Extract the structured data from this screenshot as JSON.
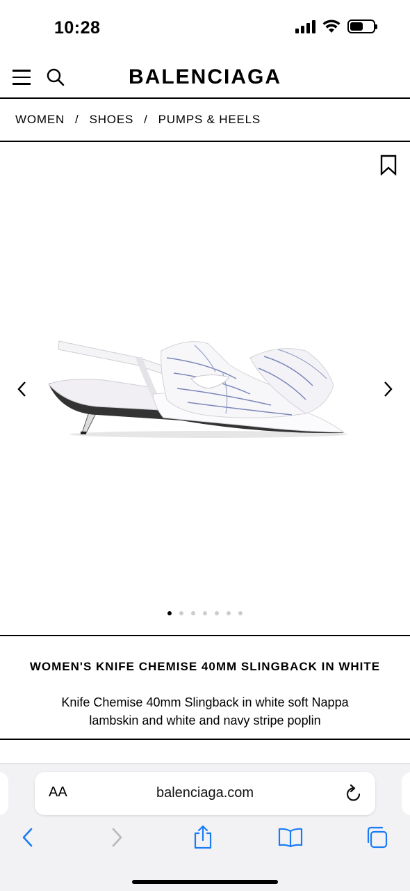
{
  "status_bar": {
    "time": "10:28"
  },
  "header": {
    "brand": "BALENCIAGA"
  },
  "breadcrumb": [
    {
      "label": "WOMEN"
    },
    {
      "label": "SHOES"
    },
    {
      "label": "PUMPS & HEELS"
    }
  ],
  "breadcrumb_separator": "/",
  "gallery": {
    "image_count": 7,
    "active_index": 0
  },
  "product": {
    "title": "WOMEN'S KNIFE CHEMISE 40MM SLINGBACK IN WHITE",
    "description": "Knife Chemise 40mm Slingback in white soft Nappa lambskin and white and navy stripe poplin"
  },
  "browser": {
    "text_size_label": "AA",
    "url": "balenciaga.com",
    "accent_color": "#1a7cf5",
    "disabled_color": "#b8b8bc"
  },
  "icons": {
    "menu": "hamburger-icon",
    "search": "search-icon",
    "wishlist": "bookmark-icon",
    "prev": "chevron-left-icon",
    "next": "chevron-right-icon",
    "reload": "reload-icon",
    "back": "back-icon",
    "forward": "forward-icon",
    "share": "share-icon",
    "bookmarks": "book-icon",
    "tabs": "tabs-icon"
  }
}
